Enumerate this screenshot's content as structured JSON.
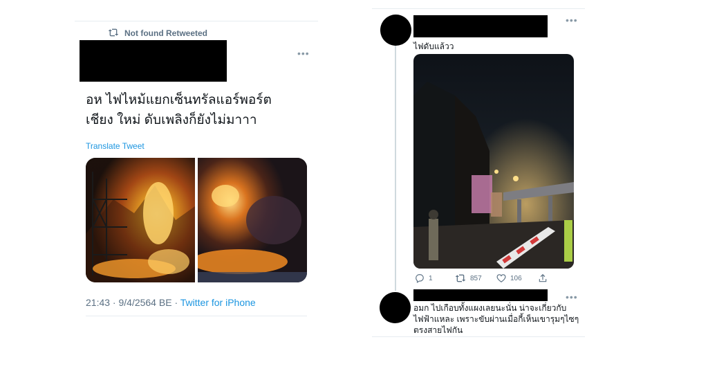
{
  "left_tweet": {
    "retweet_label": "Not found Retweeted",
    "text_line1": "อห ไฟไหม้แยกเซ็นทรัลแอร์พอร์ต",
    "text_line2": "เชียง ใหม่ ดับเพลิงก็ยังไม่มาาา",
    "translate": "Translate Tweet",
    "time": "21:43 · 9/4/2564 BE",
    "separator": "·",
    "source": "Twitter for iPhone"
  },
  "right_thread": {
    "reply1": {
      "text": "ไฟดับแล้วว",
      "actions": {
        "replies": "1",
        "retweets": "857",
        "likes": "106"
      }
    },
    "reply2": {
      "line1": "อมก ไปเกือบทั้งแผงเลยนะนั่น น่าจะเกี่ยวกับ",
      "line2": "ไฟฟ้าแหละ เพราะขับผ่านเมื่อกี้เห็นเขารุมๆไซๆ",
      "line3": "ตรงสายไฟกัน"
    }
  },
  "icons": {
    "more": "more-icon",
    "retweet": "retweet-icon",
    "reply": "reply-icon",
    "like": "heart-icon",
    "share": "share-icon"
  },
  "colors": {
    "link": "#1b95e0",
    "muted": "#5b7083",
    "divider": "#e6ecf0",
    "thread_line": "#cfd9de"
  }
}
